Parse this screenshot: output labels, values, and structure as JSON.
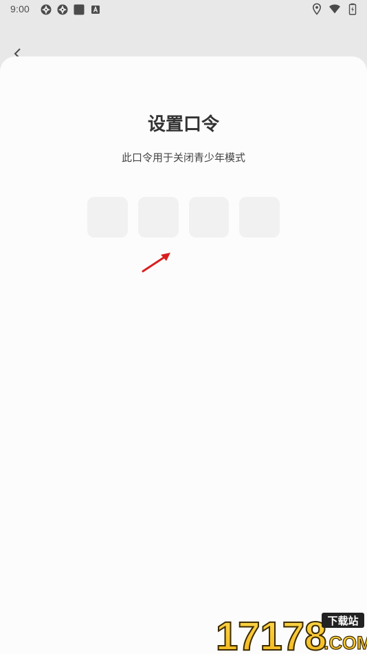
{
  "status_bar": {
    "time": "9:00",
    "left_icons": [
      "aperture-icon",
      "aperture-icon",
      "square-icon",
      "a-badge-icon"
    ],
    "right_icons": [
      "location-icon",
      "wifi-icon",
      "battery-icon"
    ]
  },
  "sheet": {
    "title": "设置口令",
    "subtitle": "此口令用于关闭青少年模式",
    "code_box_count": 4
  },
  "watermark": {
    "brand": "17178",
    "domain": "COM",
    "badge": "下载站"
  },
  "colors": {
    "background": "#e8e8e8",
    "sheet": "#fcfcfc",
    "code_box": "#f1f1f1",
    "title": "#333333",
    "arrow": "#d81e1e"
  }
}
